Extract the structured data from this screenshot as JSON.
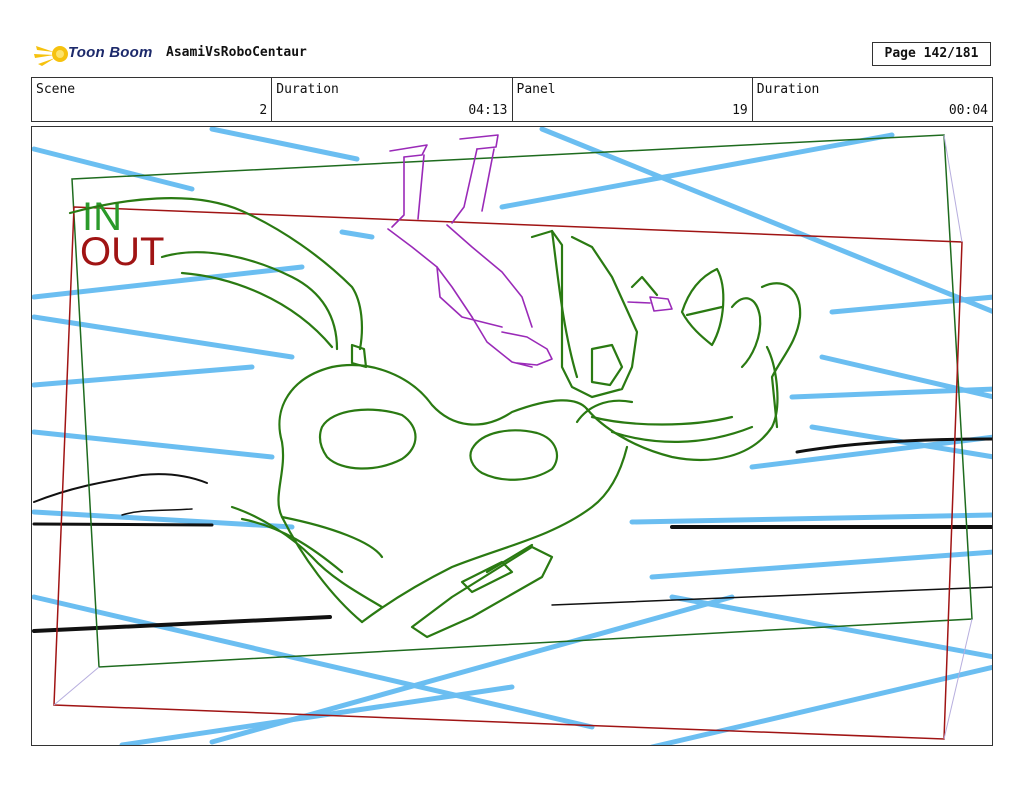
{
  "header": {
    "logo_text": "Toon Boom",
    "project_title": "AsamiVsRoboCentaur",
    "page_label": "Page 142/181"
  },
  "info": [
    {
      "label": "Scene",
      "value": "2"
    },
    {
      "label": "Duration",
      "value": "04:13"
    },
    {
      "label": "Panel",
      "value": "19"
    },
    {
      "label": "Duration",
      "value": "00:04"
    }
  ],
  "panel": {
    "in_label": "IN",
    "out_label": "OUT",
    "colors": {
      "in_frame": "#1e6b1e",
      "out_frame": "#a01414",
      "speed_lines": "#5bb8f0",
      "robot_sketch": "#2a7a12",
      "character_sketch": "#9a2ab8"
    }
  }
}
